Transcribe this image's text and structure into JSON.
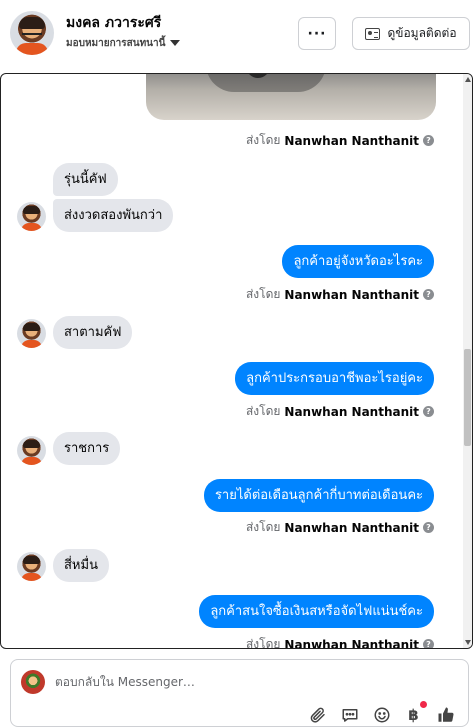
{
  "header": {
    "page_name": "มงคล ภวาระศรี",
    "assign_label": "มอบหมายการสนทนานี้",
    "more_label": "···",
    "contact_label": "ดูข้อมูลติดต่อ"
  },
  "conversation": {
    "sent_by_prefix": "ส่งโดย",
    "sender_name": "Nanwhan Nanthanit",
    "help_icon": "?",
    "messages": [
      {
        "from": "customer",
        "text": "รุ่นนี้คัฟ"
      },
      {
        "from": "customer",
        "text": "ส่งงวดสองพันกว่า"
      },
      {
        "from": "page",
        "text": "ลูกค้าอยู่จังหวัดอะไรคะ"
      },
      {
        "from": "customer",
        "text": "สาตามคัฟ"
      },
      {
        "from": "page",
        "text": "ลูกค้าประกรอบอาชีพอะไรอยู่คะ"
      },
      {
        "from": "customer",
        "text": "ราชการ"
      },
      {
        "from": "page",
        "text": "รายได้ต่อเดือนลูกค้ากี่บาทต่อเดือนคะ"
      },
      {
        "from": "customer",
        "text": "สี่หมื่น"
      },
      {
        "from": "page",
        "text": "ลูกค้าสนใจซื้อเงินสหรือจัดไฟแน่นช์คะ"
      }
    ]
  },
  "composer": {
    "placeholder": "ตอบกลับใน Messenger…",
    "baht_label": "฿",
    "icons": [
      "paperclip-icon",
      "chat-bubble-icon",
      "emoji-icon",
      "baht-icon",
      "thumbs-up-icon"
    ]
  }
}
